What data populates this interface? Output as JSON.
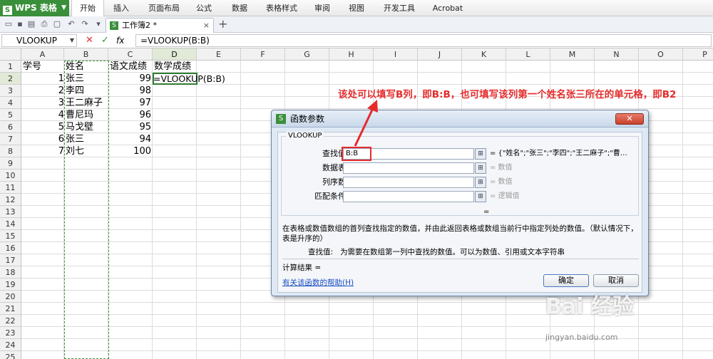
{
  "app": {
    "name": "WPS 表格",
    "logo_letter": "S",
    "brand_color": "#3a8f3a"
  },
  "menu": [
    "开始",
    "插入",
    "页面布局",
    "公式",
    "数据",
    "表格样式",
    "审阅",
    "视图",
    "开发工具",
    "Acrobat"
  ],
  "menu_active": "开始",
  "doc_tab": {
    "title": "工作簿2 *"
  },
  "formula_bar": {
    "name_box": "VLOOKUP",
    "cancel": "✕",
    "confirm": "✓",
    "fx": "fx",
    "formula": "=VLOOKUP(B:B)"
  },
  "columns": [
    "A",
    "B",
    "C",
    "D",
    "E",
    "F",
    "G",
    "H",
    "I",
    "J",
    "K",
    "L",
    "M",
    "N",
    "O",
    "P"
  ],
  "rows": [
    "1",
    "2",
    "3",
    "4",
    "5",
    "6",
    "7",
    "8",
    "9",
    "10",
    "11",
    "12",
    "13",
    "14",
    "15",
    "16",
    "17",
    "18",
    "19",
    "20",
    "21",
    "22",
    "23",
    "24",
    "25"
  ],
  "sheet": {
    "headers": {
      "A": "学号",
      "B": "姓名",
      "C": "语文成绩",
      "D": "数学成绩"
    },
    "data": [
      {
        "A": "1",
        "B": "张三",
        "C": "99"
      },
      {
        "A": "2",
        "B": "李四",
        "C": "98"
      },
      {
        "A": "3",
        "B": "王二麻子",
        "C": "97"
      },
      {
        "A": "4",
        "B": "曹尼玛",
        "C": "96"
      },
      {
        "A": "5",
        "B": "马戈壁",
        "C": "95"
      },
      {
        "A": "6",
        "B": "张三",
        "C": "94"
      },
      {
        "A": "7",
        "B": "刘七",
        "C": "100"
      }
    ],
    "active_cell": "D2",
    "active_value": "=VLOOKUP(B:B)"
  },
  "dialog": {
    "title": "函数参数",
    "close": "✕",
    "function_name": "VLOOKUP",
    "args": [
      {
        "label": "查找值",
        "value": "B:B",
        "result": "= {\"姓名\";\"张三\";\"李四\";\"王二麻子\";\"曹…"
      },
      {
        "label": "数据表",
        "value": "",
        "result": "= 数值"
      },
      {
        "label": "列序数",
        "value": "",
        "result": "= 数值"
      },
      {
        "label": "匹配条件",
        "value": "",
        "result": "= 逻辑值"
      }
    ],
    "equals": "=",
    "description": "在表格或数值数组的首列查找指定的数值，并由此返回表格或数组当前行中指定列处的数值。（默认情况下，表是升序的）",
    "arg_desc_label": "查找值:",
    "arg_desc": "为需要在数组第一列中查找的数值。可以为数值、引用或文本字符串",
    "result_label": "计算结果 =",
    "help_link": "有关该函数的帮助(H)",
    "ok": "确定",
    "cancel": "取消"
  },
  "annotation": {
    "text": "该处可以填写B列，即B:B，也可填写该列第一个姓名张三所在的单元格，即B2",
    "color": "#e52b2b"
  },
  "watermark": {
    "logo": "Bai 经验",
    "url": "jingyan.baidu.com"
  }
}
